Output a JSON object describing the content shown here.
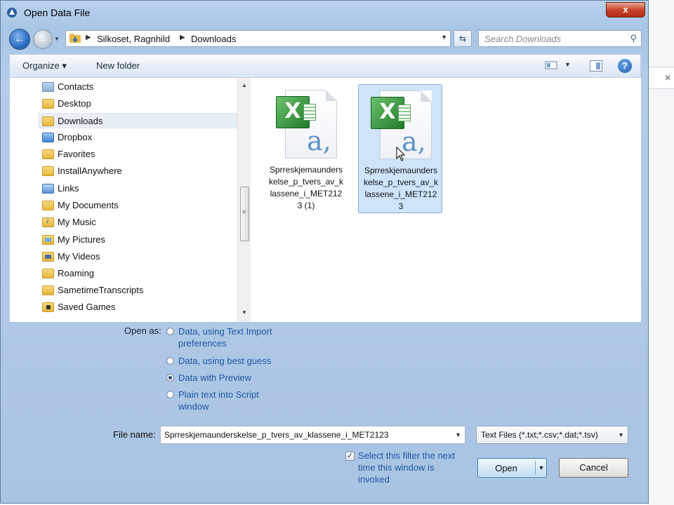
{
  "window": {
    "title": "Open Data File",
    "close_label": "x"
  },
  "address": {
    "crumbs": [
      "Silkoset, Ragnhild",
      "Downloads"
    ]
  },
  "search": {
    "placeholder": "Search Downloads"
  },
  "toolbar": {
    "organize_label": "Organize ▾",
    "new_folder_label": "New folder",
    "help_label": "?"
  },
  "nav_tree": [
    {
      "label": "Contacts",
      "icon": "contacts-folder-icon"
    },
    {
      "label": "Desktop",
      "icon": "folder-icon"
    },
    {
      "label": "Downloads",
      "icon": "downloads-folder-icon",
      "selected": true
    },
    {
      "label": "Dropbox",
      "icon": "dropbox-folder-icon"
    },
    {
      "label": "Favorites",
      "icon": "favorites-folder-icon"
    },
    {
      "label": "InstallAnywhere",
      "icon": "folder-icon"
    },
    {
      "label": "Links",
      "icon": "links-folder-icon"
    },
    {
      "label": "My Documents",
      "icon": "documents-folder-icon"
    },
    {
      "label": "My Music",
      "icon": "music-folder-icon"
    },
    {
      "label": "My Pictures",
      "icon": "pictures-folder-icon"
    },
    {
      "label": "My Videos",
      "icon": "videos-folder-icon"
    },
    {
      "label": "Roaming",
      "icon": "folder-icon"
    },
    {
      "label": "SametimeTranscripts",
      "icon": "folder-icon"
    },
    {
      "label": "Saved Games",
      "icon": "games-folder-icon"
    }
  ],
  "files": [
    {
      "name": "Sprreskjemaunderskelse_p_tvers_av_klassene_i_MET2123 (1)",
      "icon": "excel-csv-file-icon",
      "selected": false
    },
    {
      "name": "Sprreskjemaunderskelse_p_tvers_av_klassene_i_MET2123",
      "icon": "excel-csv-file-icon",
      "selected": true
    }
  ],
  "open_as": {
    "label": "Open as:",
    "options": [
      {
        "label": "Data, using Text Import preferences",
        "checked": false
      },
      {
        "label": "Data, using best guess",
        "checked": false
      },
      {
        "label": "Data with Preview",
        "checked": true
      },
      {
        "label": "Plain text into Script window",
        "checked": false
      }
    ]
  },
  "file_name": {
    "label": "File name:",
    "value": "Sprreskjemaunderskelse_p_tvers_av_klassene_i_MET2123"
  },
  "filter": {
    "value": "Text Files (*.txt;*.csv;*.dat;*.tsv)"
  },
  "remember_filter": {
    "label": "Select this filter the next time this window is invoked",
    "checked": true,
    "check_glyph": "✓"
  },
  "buttons": {
    "open": "Open",
    "cancel": "Cancel"
  }
}
